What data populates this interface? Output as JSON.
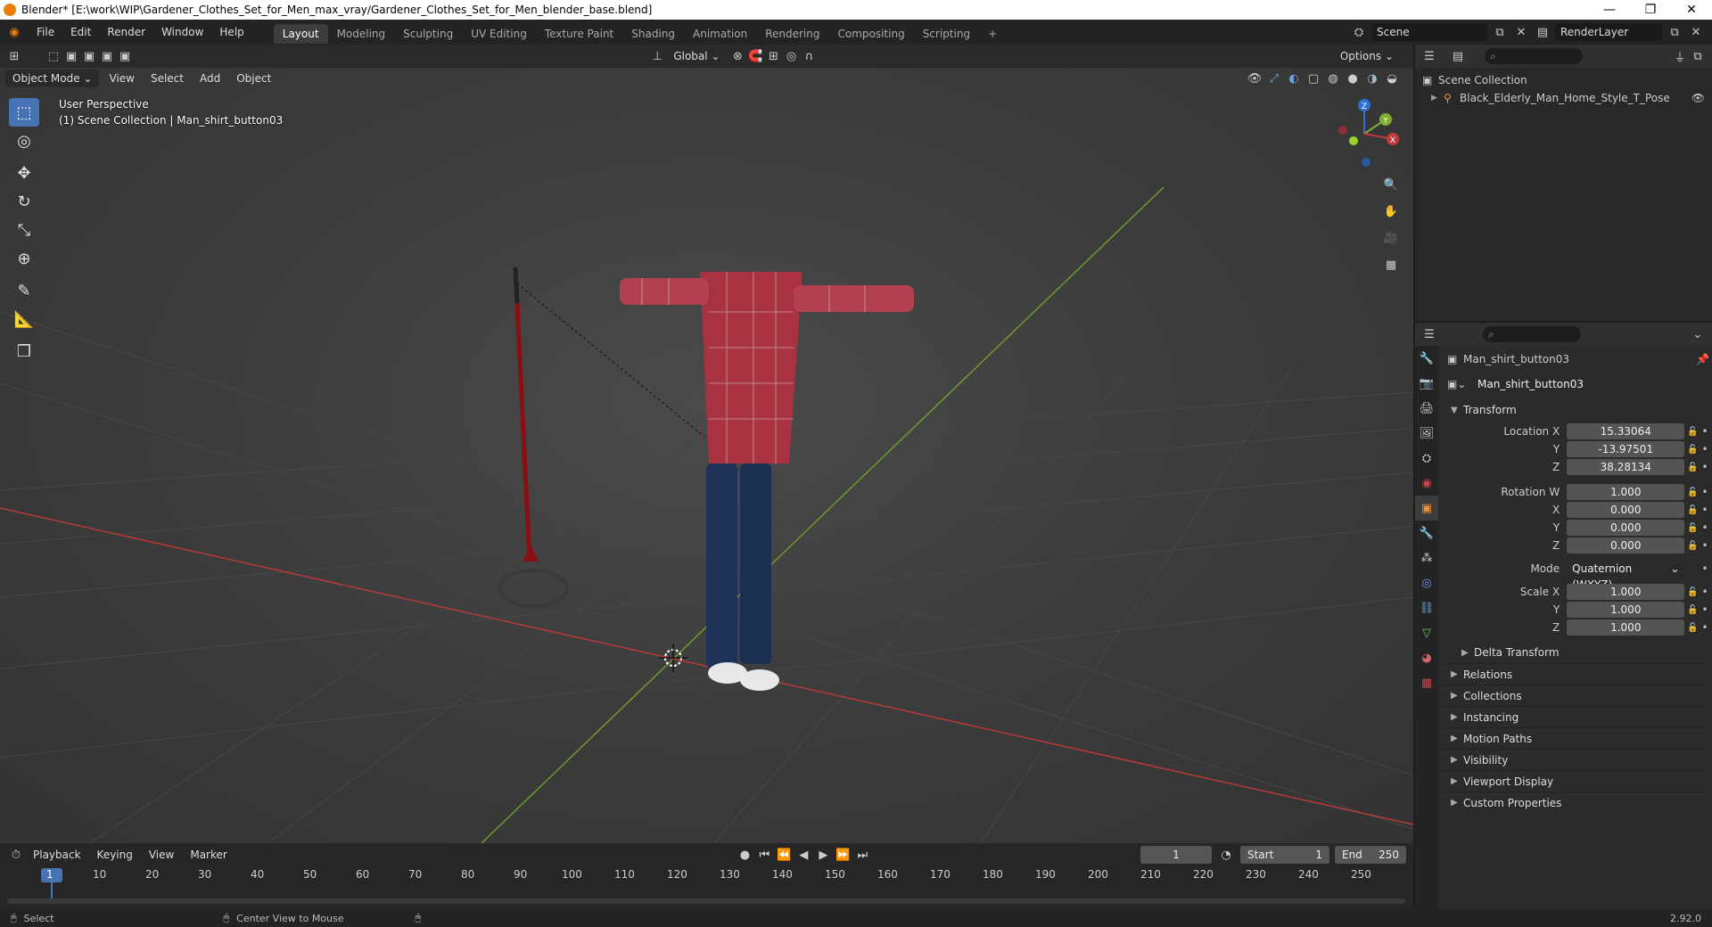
{
  "window": {
    "title": "Blender* [E:\\work\\WIP\\Gardener_Clothes_Set_for_Men_max_vray/Gardener_Clothes_Set_for_Men_blender_base.blend]",
    "minimize": "—",
    "restore": "❐",
    "close": "✕"
  },
  "menu": {
    "items": [
      "File",
      "Edit",
      "Render",
      "Window",
      "Help"
    ]
  },
  "workspaces": [
    "Layout",
    "Modeling",
    "Sculpting",
    "UV Editing",
    "Texture Paint",
    "Shading",
    "Animation",
    "Rendering",
    "Compositing",
    "Scripting"
  ],
  "active_workspace": "Layout",
  "add_workspace": "+",
  "scene": {
    "name": "Scene",
    "render_layer": "RenderLayer"
  },
  "viewport": {
    "mode": "Object Mode",
    "header_menus": [
      "View",
      "Select",
      "Add",
      "Object"
    ],
    "orientation": "Global",
    "options_label": "Options",
    "perspective_label": "User Perspective",
    "collection_label": "(1) Scene Collection | Man_shirt_button03",
    "gizmo": {
      "x": "X",
      "y": "Y",
      "z": "Z"
    },
    "colors": {
      "x_axis": "#c0393b",
      "y_axis": "#7fae2f",
      "accent": "#4772b3"
    }
  },
  "outliner": {
    "root": "Scene Collection",
    "items": [
      {
        "name": "Black_Elderly_Man_Home_Style_T_Pose"
      }
    ]
  },
  "properties": {
    "object_name": "Man_shirt_button03",
    "data_name": "Man_shirt_button03",
    "transform": {
      "title": "Transform",
      "location_label": "Location X",
      "location": {
        "x": "15.33064",
        "y": "-13.97501",
        "z": "38.28134"
      },
      "rotation_label": "Rotation W",
      "rotation": {
        "w": "1.000",
        "x": "0.000",
        "y": "0.000",
        "z": "0.000"
      },
      "mode_label": "Mode",
      "mode": "Quaternion (WXYZ)",
      "scale_label": "Scale X",
      "scale": {
        "x": "1.000",
        "y": "1.000",
        "z": "1.000"
      },
      "axis_y": "Y",
      "axis_z": "Z",
      "axis_x": "X",
      "delta": "Delta Transform"
    },
    "sections": [
      "Relations",
      "Collections",
      "Instancing",
      "Motion Paths",
      "Visibility",
      "Viewport Display",
      "Custom Properties"
    ]
  },
  "timeline": {
    "menus": [
      "Playback",
      "Keying",
      "View",
      "Marker"
    ],
    "current_frame": "1",
    "start_label": "Start",
    "start": "1",
    "end_label": "End",
    "end": "250",
    "ticks": [
      "1",
      "10",
      "20",
      "30",
      "40",
      "50",
      "60",
      "70",
      "80",
      "90",
      "100",
      "110",
      "120",
      "130",
      "140",
      "150",
      "160",
      "170",
      "180",
      "190",
      "200",
      "210",
      "220",
      "230",
      "240",
      "250"
    ]
  },
  "status": {
    "left": "Select",
    "middle": "Center View to Mouse",
    "version": "2.92.0"
  }
}
